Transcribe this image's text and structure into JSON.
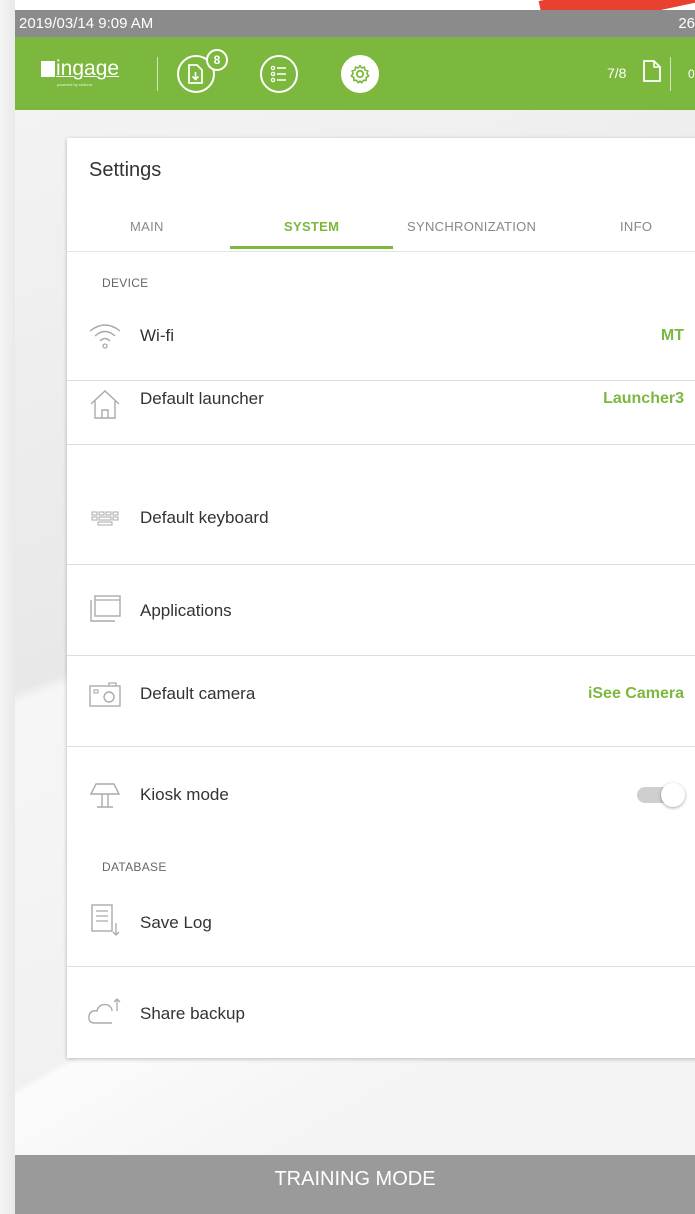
{
  "status_bar": {
    "datetime": "2019/03/14  9:09 AM",
    "battery": "26"
  },
  "app_bar": {
    "logo_text": "ingage",
    "logo_tagline": "powered by sedona",
    "download_badge": "8",
    "page_counter": "7/8",
    "extra": "0"
  },
  "settings": {
    "title": "Settings",
    "tabs": [
      {
        "label": "MAIN",
        "active": false
      },
      {
        "label": "SYSTEM",
        "active": true
      },
      {
        "label": "SYNCHRONIZATION",
        "active": false
      },
      {
        "label": "INFO",
        "active": false
      }
    ],
    "sections": {
      "device": "DEVICE",
      "database": "DATABASE"
    },
    "rows": [
      {
        "label": "Wi-fi",
        "value": "MT",
        "icon": "wifi-icon"
      },
      {
        "label": "Default launcher",
        "value": "Launcher3",
        "icon": "home-icon"
      },
      {
        "label": "Default keyboard",
        "value": "",
        "icon": "keyboard-icon"
      },
      {
        "label": "Applications",
        "value": "",
        "icon": "applications-icon"
      },
      {
        "label": "Default camera",
        "value": "iSee Camera",
        "icon": "camera-icon"
      },
      {
        "label": "Kiosk mode",
        "value": "",
        "icon": "kiosk-icon",
        "toggle_on": false
      },
      {
        "label": "Save Log",
        "value": "",
        "icon": "save-log-icon"
      },
      {
        "label": "Share backup",
        "value": "",
        "icon": "cloud-upload-icon"
      }
    ]
  },
  "footer": {
    "label": "TRAINING MODE"
  },
  "colors": {
    "accent": "#7cb83e",
    "status_bar": "#8b8b8b",
    "footer": "#9a9a9a",
    "brand_red": "#e8412f"
  }
}
